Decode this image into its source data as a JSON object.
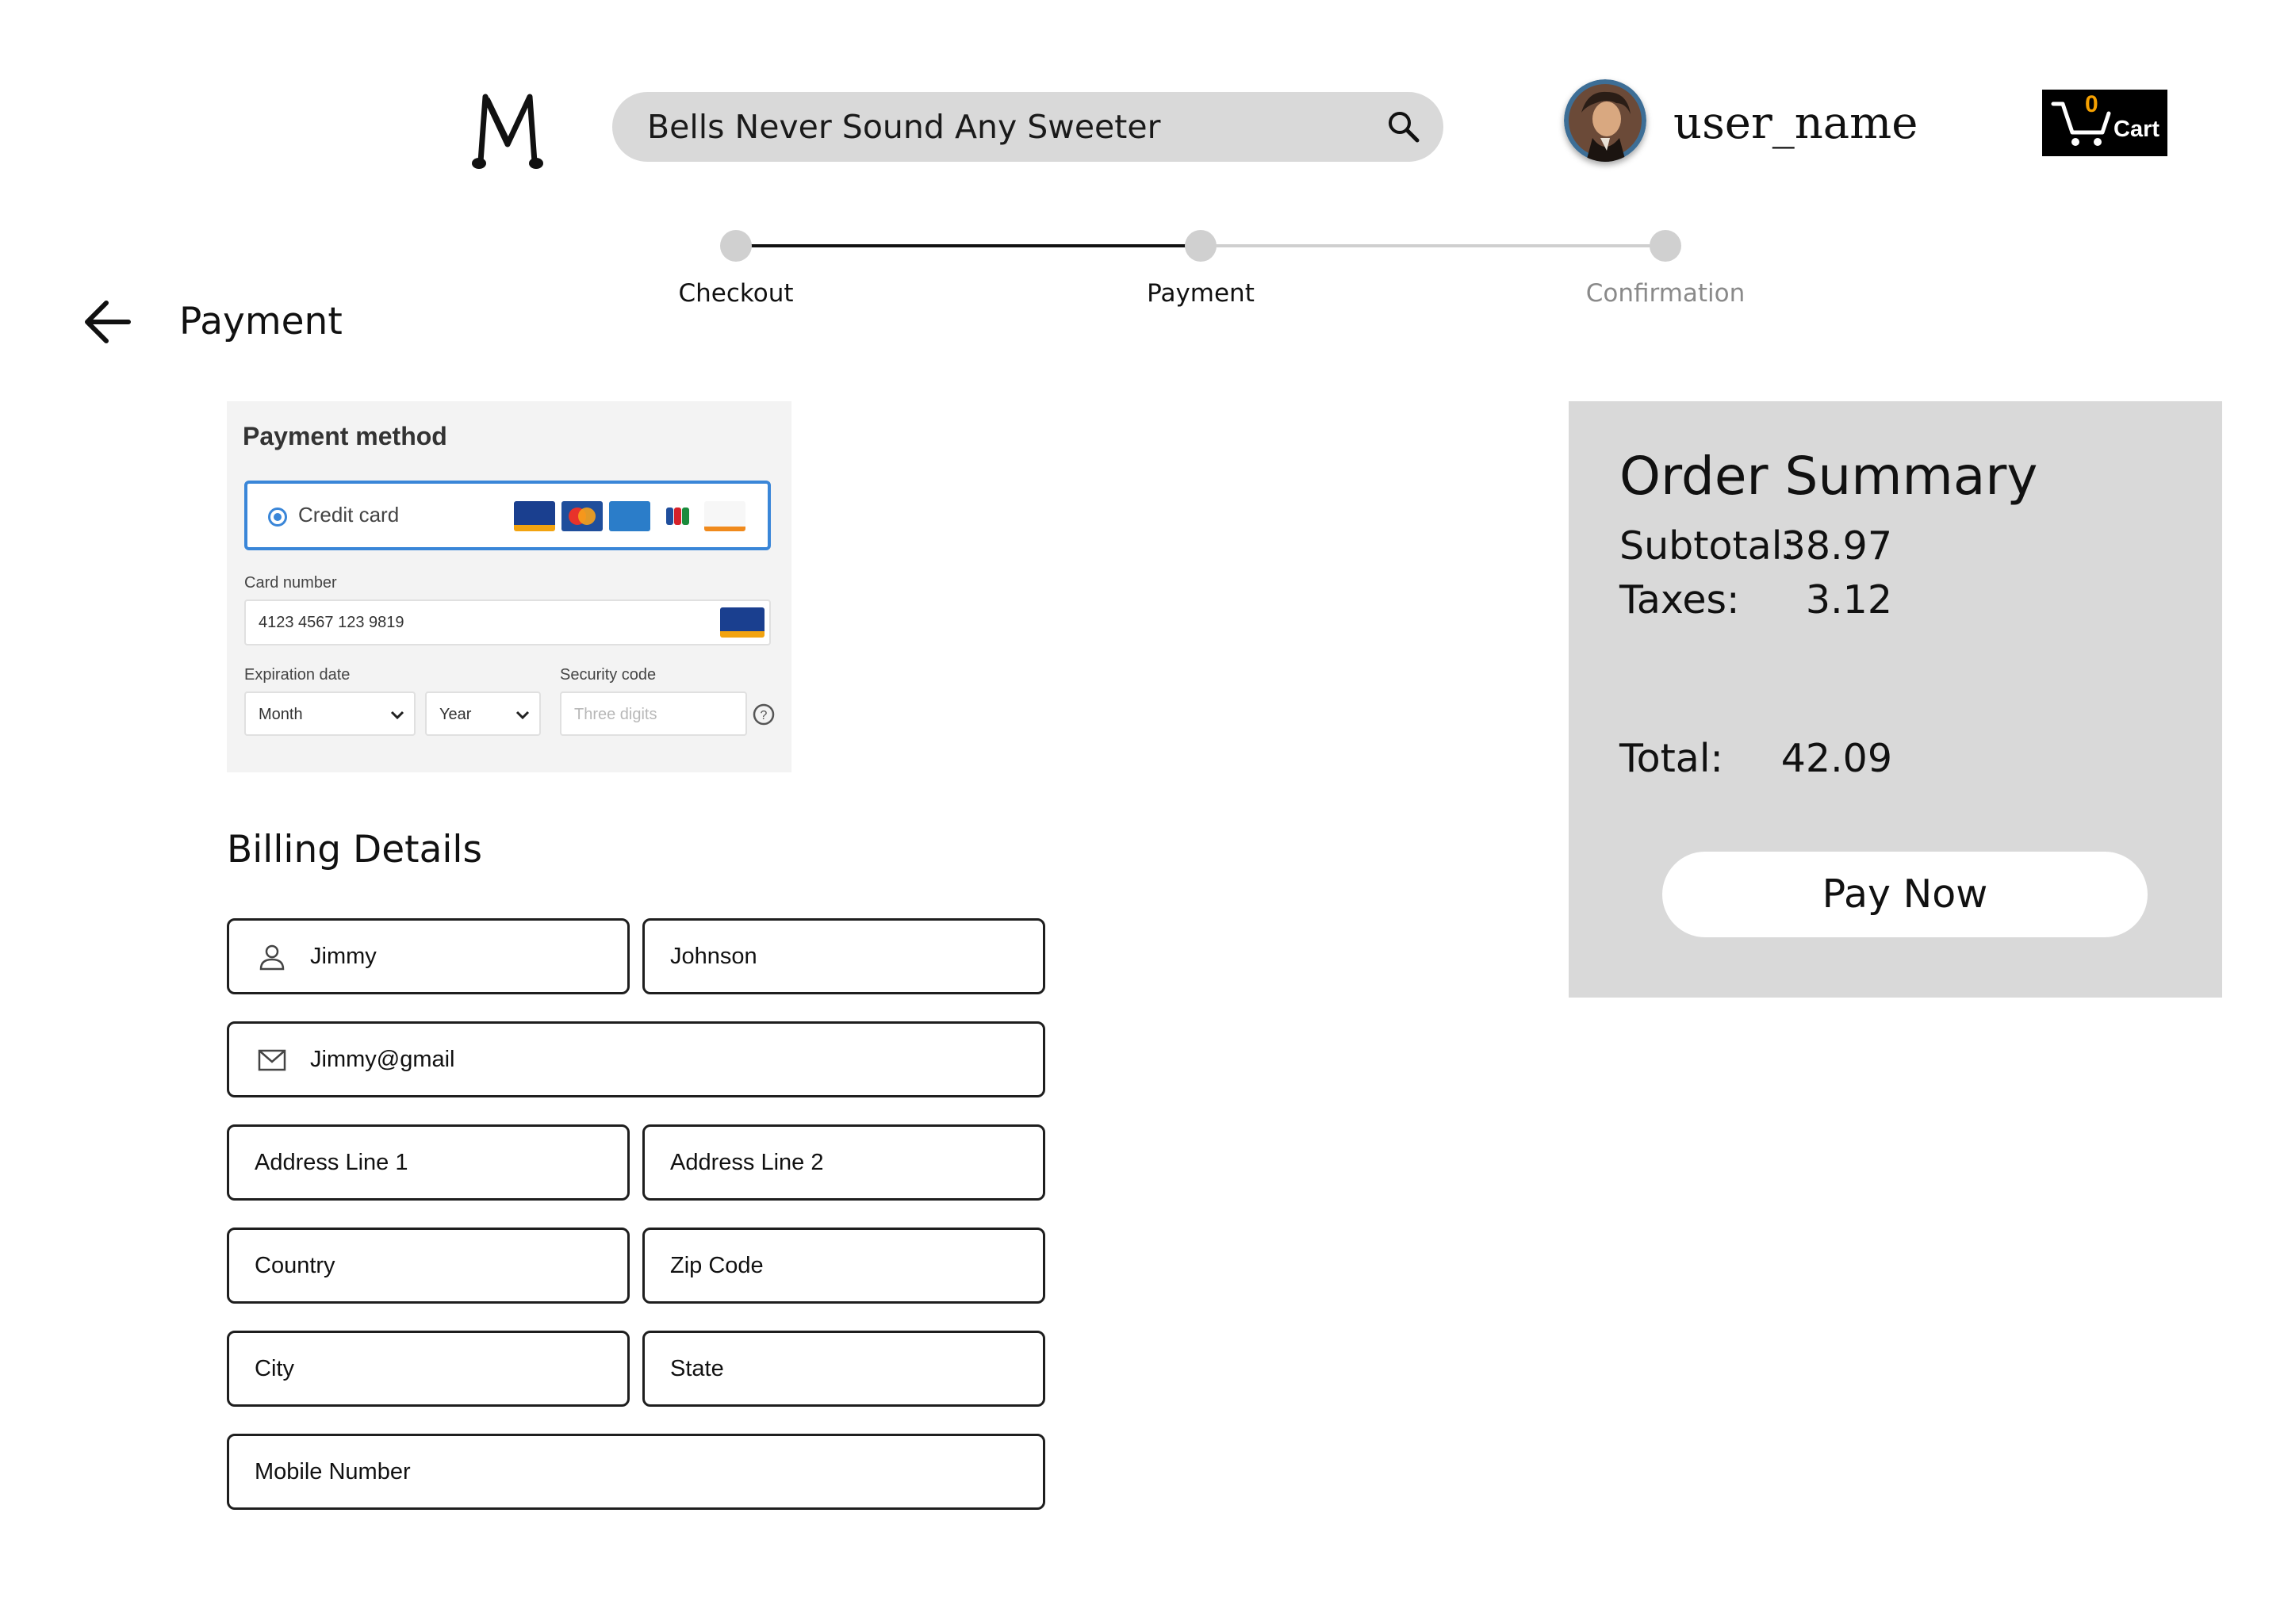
{
  "header": {
    "search_value": "Bells Never Sound Any Sweeter",
    "username": "user_name",
    "cart_count": "0",
    "cart_label": "Cart"
  },
  "progress": {
    "steps": [
      {
        "label": "Checkout",
        "state": "done"
      },
      {
        "label": "Payment",
        "state": "current"
      },
      {
        "label": "Confirmation",
        "state": "pending"
      }
    ]
  },
  "page": {
    "title": "Payment"
  },
  "payment_method": {
    "title": "Payment method",
    "option_label": "Credit card",
    "card_number_label": "Card number",
    "card_number_value": "4123 4567 123 9819",
    "expiration_label": "Expiration date",
    "month_value": "Month",
    "year_value": "Year",
    "security_label": "Security code",
    "security_placeholder": "Three digits",
    "card_brands": [
      "visa",
      "mastercard",
      "amex",
      "jcb",
      "discover"
    ]
  },
  "billing": {
    "title": "Billing Details",
    "first_name": "Jimmy",
    "last_name": "Johnson",
    "email": "Jimmy@gmail",
    "address1": "Address Line 1",
    "address2": "Address Line 2",
    "country": "Country",
    "zip": "Zip Code",
    "city": "City",
    "state": "State",
    "mobile": "Mobile Number"
  },
  "summary": {
    "title": "Order Summary",
    "subtotal_label": "Subtotal:",
    "subtotal_value": "38.97",
    "taxes_label": "Taxes:",
    "taxes_value": "3.12",
    "total_label": "Total:",
    "total_value": "42.09",
    "pay_label": "Pay Now"
  },
  "colors": {
    "accent_blue": "#3a86d8",
    "summary_bg": "#d9d9d9",
    "search_bg": "#d9d9d9",
    "cart_orange": "#f5a000"
  }
}
